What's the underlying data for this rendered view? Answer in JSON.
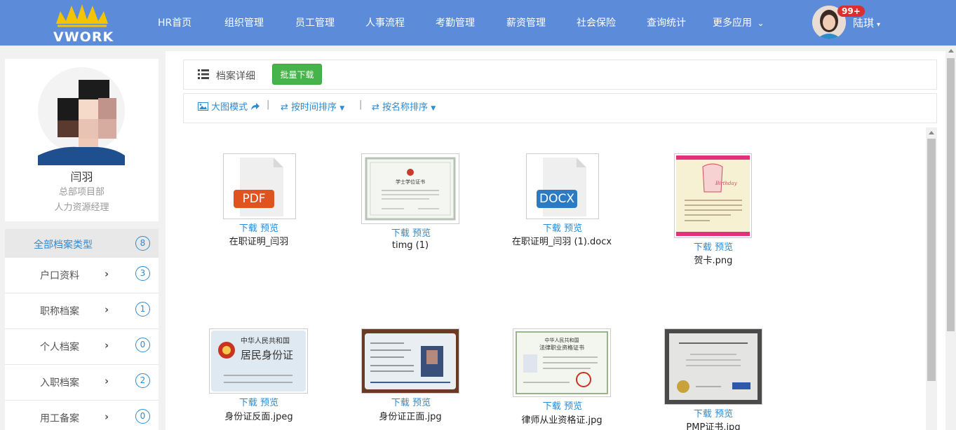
{
  "brand": {
    "logo_text": "VWORK",
    "bar_color": "#5b8bd9"
  },
  "nav": {
    "items": [
      "HR首页",
      "组织管理",
      "员工管理",
      "人事流程",
      "考勤管理",
      "薪资管理",
      "社会保险",
      "查询统计",
      "更多应用"
    ],
    "more_caret": "⌄"
  },
  "user": {
    "name": "陆琪",
    "badge": "99+",
    "caret": "▾"
  },
  "profile": {
    "name": "闫羽",
    "department": "总部项目部",
    "role": "人力资源经理"
  },
  "categories": [
    {
      "label": "全部档案类型",
      "count": "8",
      "active": true
    },
    {
      "label": "户口资料",
      "count": "3"
    },
    {
      "label": "职称档案",
      "count": "1"
    },
    {
      "label": "个人档案",
      "count": "0"
    },
    {
      "label": "入职档案",
      "count": "2"
    },
    {
      "label": "用工备案",
      "count": "0"
    }
  ],
  "toolbar": {
    "title": "档案详细",
    "batch_download": "批量下载"
  },
  "sort": {
    "big_mode": "大图模式",
    "by_time": "按时间排序",
    "by_name": "按名称排序",
    "sep": "|"
  },
  "file_actions": {
    "download": "下载",
    "preview": "预览"
  },
  "files": [
    {
      "name": "在职证明_闫羽",
      "type": "PDF",
      "icon": "pdf-file-icon",
      "tag_color": "#e0531f"
    },
    {
      "name": "timg (1)",
      "type": "image",
      "icon": "degree-certificate-thumbnail"
    },
    {
      "name": "在职证明_闫羽 (1).docx",
      "type": "DOCX",
      "icon": "docx-file-icon",
      "tag_color": "#2a7bc4"
    },
    {
      "name": "贺卡.png",
      "type": "image",
      "icon": "greeting-card-thumbnail"
    },
    {
      "name": "身份证反面.jpeg",
      "type": "image",
      "icon": "id-card-back-thumbnail"
    },
    {
      "name": "身份证正面.jpg",
      "type": "image",
      "icon": "id-card-front-thumbnail"
    },
    {
      "name": "律师从业资格证.jpg",
      "type": "image",
      "icon": "lawyer-certificate-thumbnail"
    },
    {
      "name": "PMP证书.jpg",
      "type": "image",
      "icon": "pmp-certificate-thumbnail"
    }
  ],
  "thumb_text": {
    "degree": "学士学位证书",
    "id_back_title": "中华人民共和国",
    "id_back_sub": "居民身份证",
    "lawyer_title": "中华人民共和国",
    "lawyer_sub": "法律职业资格证书"
  }
}
